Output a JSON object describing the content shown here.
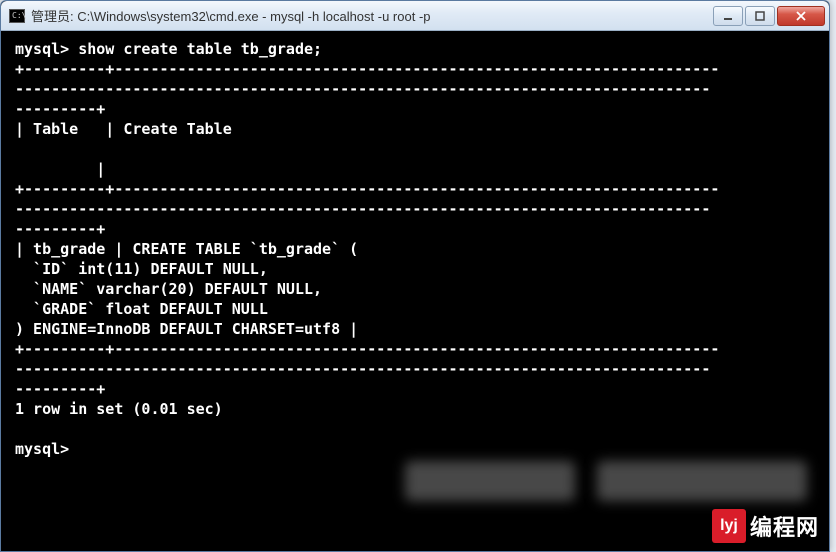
{
  "window": {
    "icon_text": "C:\\",
    "title": "管理员: C:\\Windows\\system32\\cmd.exe - mysql  -h localhost -u root -p"
  },
  "terminal": {
    "prompt1": "mysql> show create table tb_grade;",
    "divider1a": "+---------+-------------------------------------------------------------------",
    "divider1b": "-----------------------------------------------------------------------------",
    "divider1c": "---------+",
    "header": "| Table   | Create Table",
    "blank": "         |",
    "divider2a": "+---------+-------------------------------------------------------------------",
    "divider2b": "-----------------------------------------------------------------------------",
    "divider2c": "---------+",
    "row1": "| tb_grade | CREATE TABLE `tb_grade` (",
    "row2": "  `ID` int(11) DEFAULT NULL,",
    "row3": "  `NAME` varchar(20) DEFAULT NULL,",
    "row4": "  `GRADE` float DEFAULT NULL",
    "row5": ") ENGINE=InnoDB DEFAULT CHARSET=utf8 |",
    "divider3a": "+---------+-------------------------------------------------------------------",
    "divider3b": "-----------------------------------------------------------------------------",
    "divider3c": "---------+",
    "status": "1 row in set (0.01 sec)",
    "prompt2": "mysql>"
  },
  "watermark": {
    "logo": "lyj",
    "text": "编程网"
  }
}
